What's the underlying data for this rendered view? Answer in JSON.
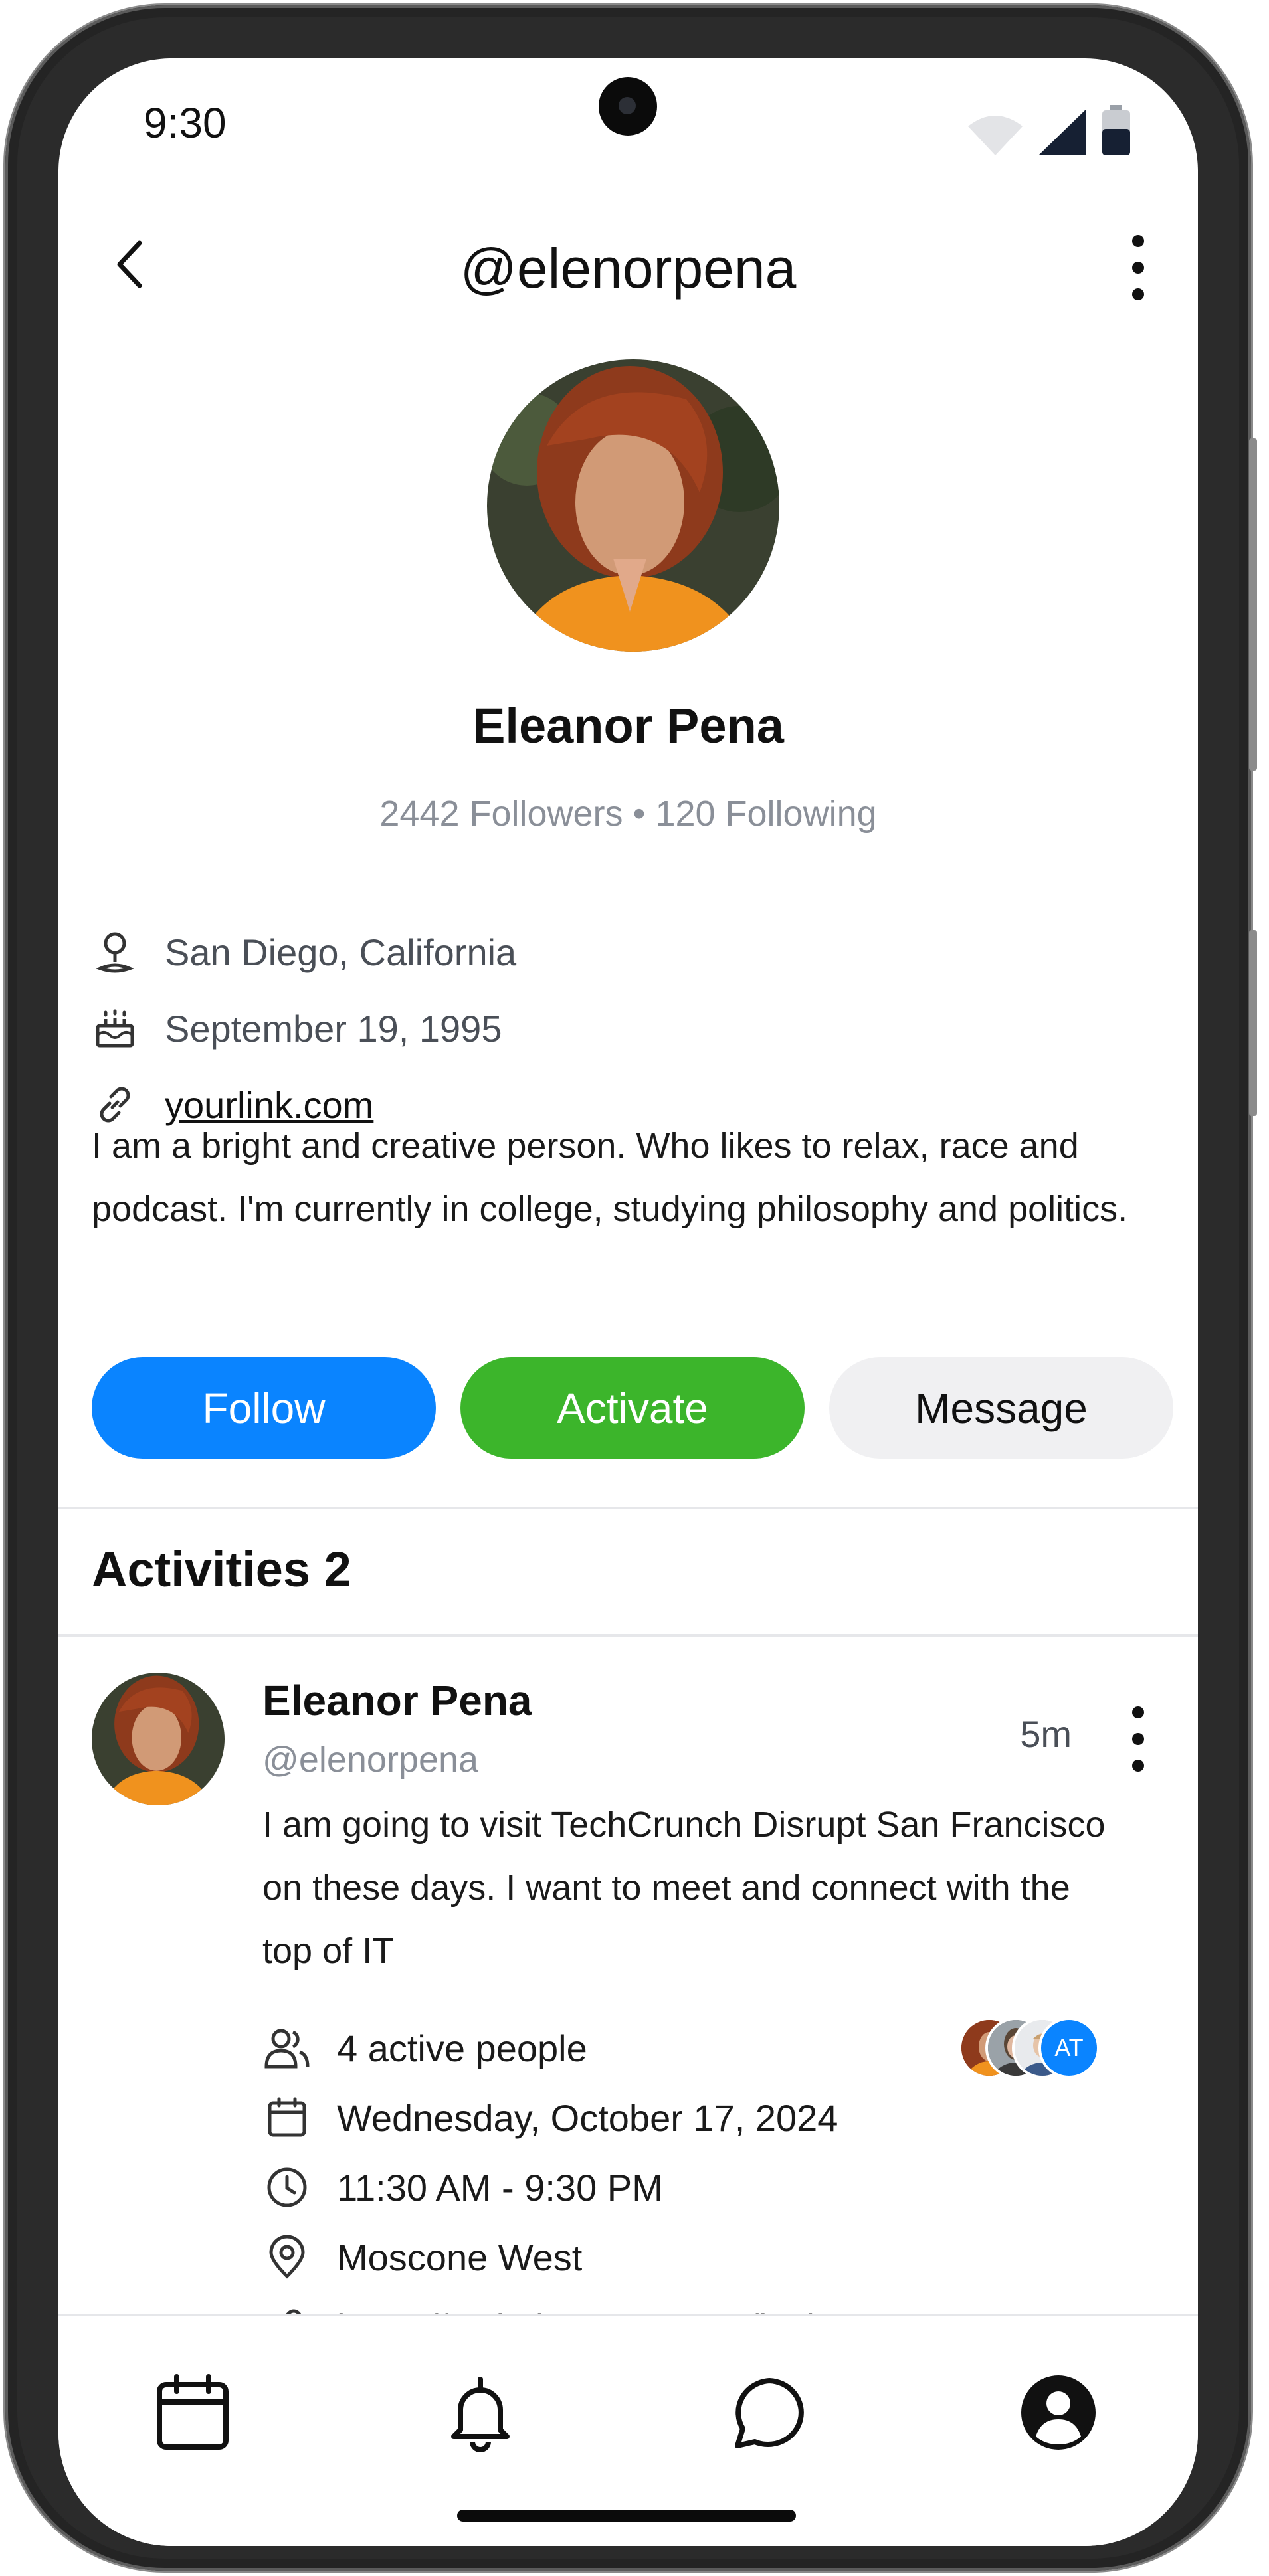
{
  "status_bar": {
    "time": "9:30"
  },
  "header": {
    "title": "@elenorpena"
  },
  "profile": {
    "name": "Eleanor Pena",
    "stats": "2442 Followers • 120 Following",
    "location": "San Diego, California",
    "birthday": "September 19, 1995",
    "website": "yourlink.com",
    "bio": "I am a bright and creative person. Who likes to relax, race and podcast. I'm currently in college, studying philosophy and politics."
  },
  "actions": {
    "follow": "Follow",
    "activate": "Activate",
    "message": "Message"
  },
  "activities": {
    "title": "Activities 2",
    "items": [
      {
        "name": "Eleanor Pena",
        "handle": "@elenorpena",
        "time": "5m",
        "text": "I am going to visit TechCrunch Disrupt San Francisco on these days. I want to meet and connect with the top of IT",
        "people": "4 active people",
        "people_avatar_initials": "AT",
        "date": "Wednesday, October 17, 2024",
        "hours": "11:30 AM - 9:30 PM",
        "place": "Moscone West",
        "link": "https://websitename.com/invite"
      }
    ]
  },
  "icons": {
    "back": "chevron-left-icon",
    "more": "more-vertical-icon",
    "location": "location-pin-icon",
    "birthday": "cake-icon",
    "website": "link-icon",
    "people": "users-icon",
    "date": "calendar-icon",
    "hours": "clock-icon",
    "place": "map-pin-icon",
    "nav": [
      "calendar-icon",
      "bell-icon",
      "chat-icon",
      "profile-icon"
    ]
  },
  "colors": {
    "follow": "#0a84ff",
    "activate": "#3cb52b",
    "message_bg": "#f0f0f2",
    "muted_text": "#8a8f98"
  }
}
